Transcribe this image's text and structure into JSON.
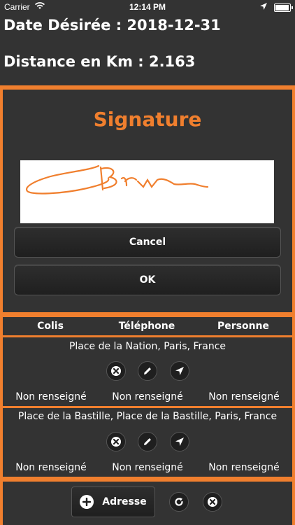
{
  "status_bar": {
    "carrier": "Carrier",
    "time": "12:14 PM"
  },
  "header": {
    "date_line": "Date Désirée : 2018-12-31",
    "distance_line": "Distance en Km : 2.163"
  },
  "signature": {
    "title": "Signature",
    "cancel_label": "Cancel",
    "ok_label": "OK"
  },
  "table": {
    "columns": [
      "Colis",
      "Téléphone",
      "Personne"
    ],
    "rows": [
      {
        "address": "Place de la Nation, Paris, France",
        "colis": "Non renseigné",
        "telephone": "Non renseigné",
        "personne": "Non renseigné"
      },
      {
        "address": "Place de la Bastille, Place de la Bastille, Paris, France",
        "colis": "Non renseigné",
        "telephone": "Non renseigné",
        "personne": "Non renseigné"
      }
    ]
  },
  "footer": {
    "add_address_label": "Adresse"
  },
  "colors": {
    "accent": "#f07f2e",
    "panel": "#333333",
    "button": "#1f1f1f"
  },
  "icons": [
    "wifi-icon",
    "location-arrow-icon",
    "battery-icon",
    "delete-icon",
    "edit-icon",
    "navigate-icon",
    "add-icon",
    "refresh-icon",
    "clear-icon"
  ]
}
